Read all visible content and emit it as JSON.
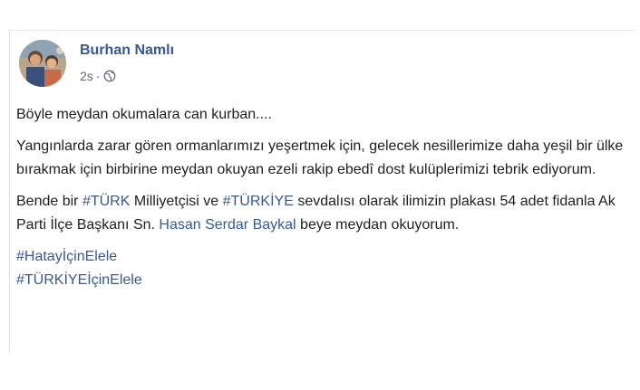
{
  "post": {
    "author": "Burhan Namlı",
    "timestamp": "2s",
    "meta_separator": "·",
    "privacy_icon": "globe-icon",
    "paragraph1": "Böyle meydan okumalara can kurban....",
    "paragraph2": "Yangınlarda zarar gören ormanlarımızı yeşertmek için, gelecek nesillerimize daha yeşil bir ülke bırakmak için birbirine meydan okuyan ezeli rakip ebedî dost kulüplerimizi tebrik ediyorum.",
    "paragraph3": {
      "t1": "Bende bir ",
      "tag_turk": "#TÜRK",
      "t2": " Milliyetçisi ve ",
      "tag_turkiye": "#TÜRKİYE",
      "t3": " sevdalısı olarak ilimizin plakası 54 adet fidanla Ak Parti İlçe Başkanı Sn. ",
      "mention": "Hasan Serdar Baykal",
      "t4": " beye meydan okuyorum."
    },
    "hashtags": [
      "#HatayİçinElele",
      "#TÜRKİYEİçinElele"
    ]
  },
  "colors": {
    "link": "#385898",
    "text": "#1c1e21",
    "meta": "#616770"
  }
}
